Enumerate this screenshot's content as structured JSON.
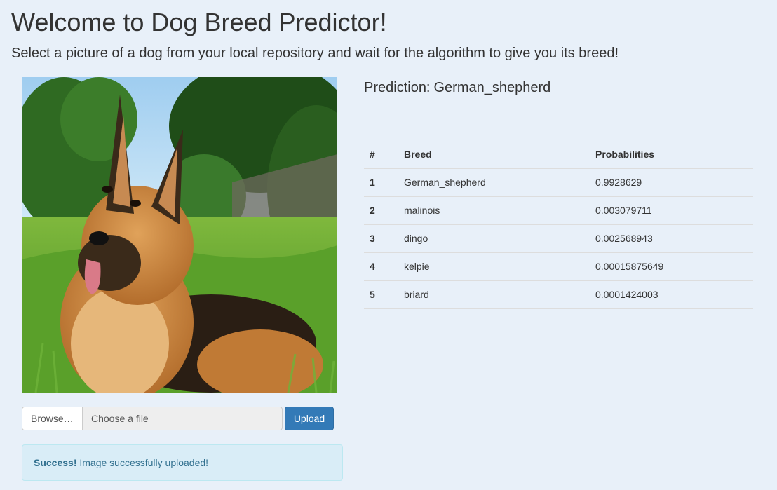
{
  "header": {
    "title": "Welcome to Dog Breed Predictor!",
    "subtitle": "Select a picture of a dog from your local repository and wait for the algorithm to give you its breed!"
  },
  "image": {
    "subject": "german-shepherd-dog-photo"
  },
  "upload": {
    "browse_label": "Browse…",
    "file_placeholder": "Choose a file",
    "upload_label": "Upload"
  },
  "alert": {
    "strong": "Success!",
    "message": "Image successfully uploaded!"
  },
  "prediction": {
    "label": "Prediction:",
    "value": "German_shepherd"
  },
  "table": {
    "headers": [
      "#",
      "Breed",
      "Probabilities"
    ],
    "rows": [
      {
        "rank": "1",
        "breed": "German_shepherd",
        "probability": "0.9928629"
      },
      {
        "rank": "2",
        "breed": "malinois",
        "probability": "0.003079711"
      },
      {
        "rank": "3",
        "breed": "dingo",
        "probability": "0.002568943"
      },
      {
        "rank": "4",
        "breed": "kelpie",
        "probability": "0.00015875649"
      },
      {
        "rank": "5",
        "breed": "briard",
        "probability": "0.0001424003"
      }
    ]
  },
  "colors": {
    "background": "#e8f0f9",
    "primary_button": "#337ab7",
    "alert_bg": "#d9edf7",
    "alert_text": "#31708f"
  }
}
